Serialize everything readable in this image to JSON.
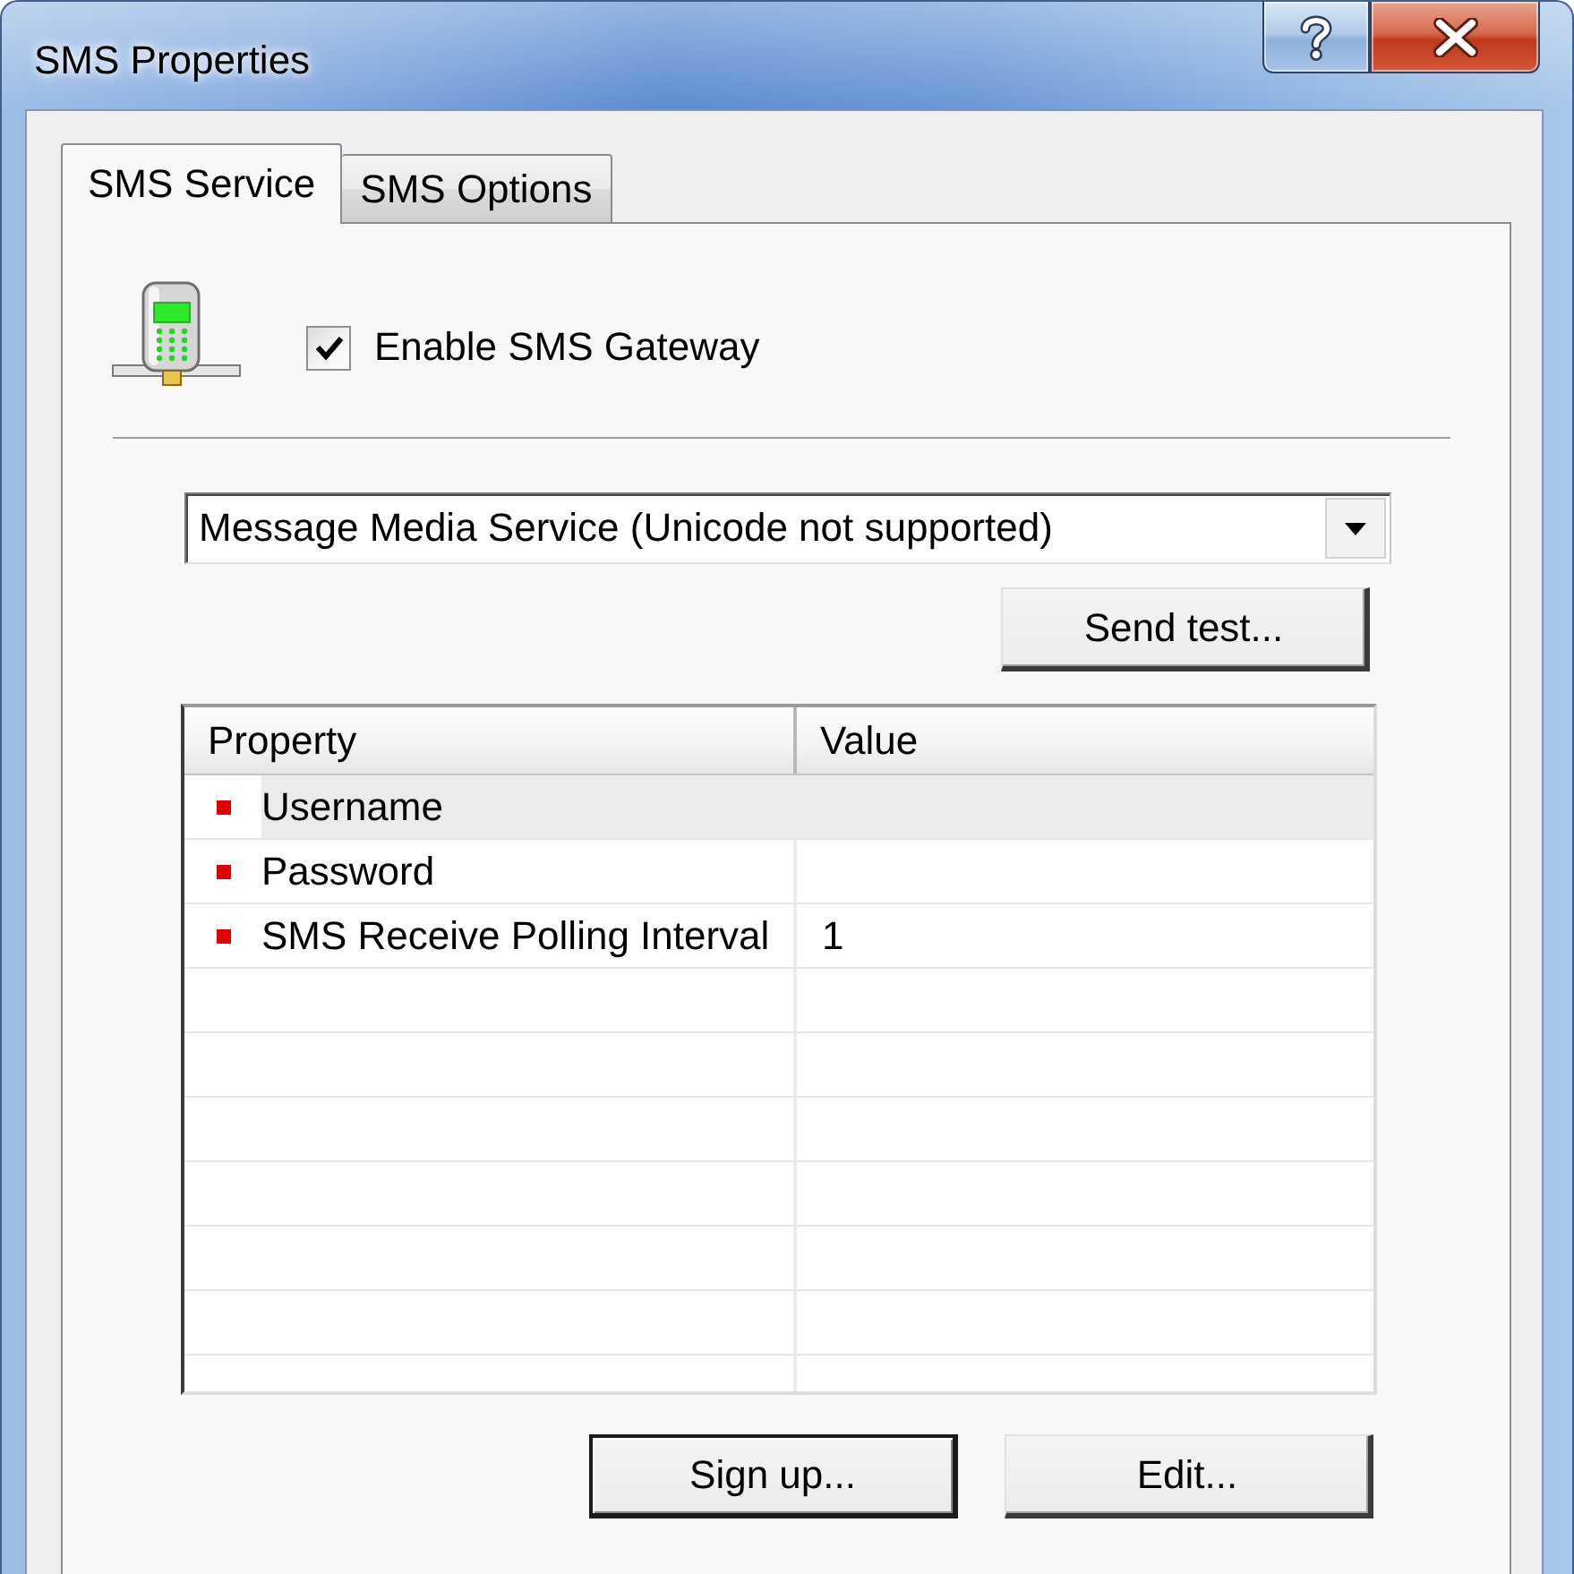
{
  "window": {
    "title": "SMS Properties"
  },
  "tabs": [
    {
      "label": "SMS Service",
      "selected": true
    },
    {
      "label": "SMS Options",
      "selected": false
    }
  ],
  "gateway": {
    "label": "Enable SMS Gateway",
    "checked": true
  },
  "service": {
    "value": "Message Media Service (Unicode not supported)"
  },
  "send_test_button": {
    "label": "Send test..."
  },
  "properties_table": {
    "columns": [
      "Property",
      "Value"
    ],
    "rows": [
      {
        "property": "Username",
        "selected": true
      },
      {
        "property": "Password",
        "selected": false
      },
      {
        "property": "SMS Receive Polling Interval",
        "value": "1",
        "selected": false
      }
    ]
  },
  "buttons": [
    {
      "label": "Sign up...",
      "default": true
    },
    {
      "label": "Edit...",
      "default": false
    }
  ]
}
